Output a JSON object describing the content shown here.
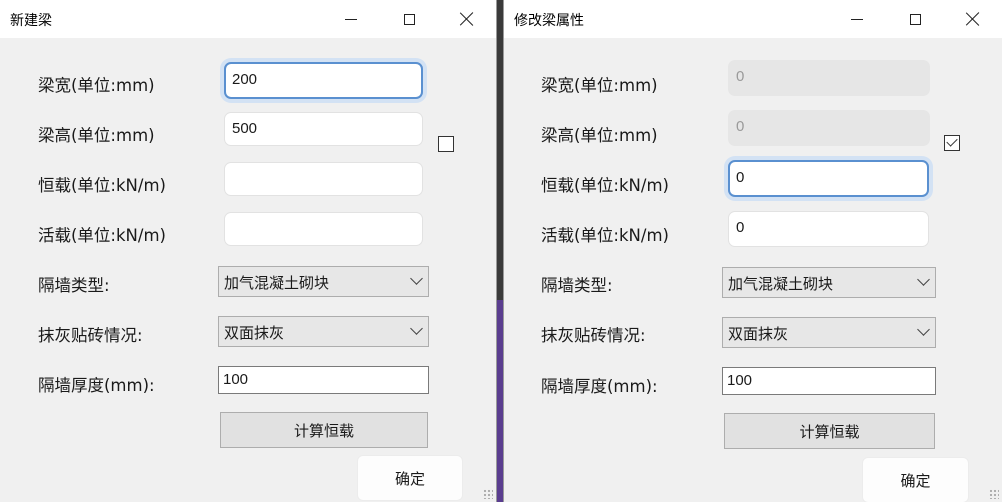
{
  "dialog_new": {
    "title": "新建梁",
    "labels": {
      "width": "梁宽(单位:mm)",
      "height": "梁高(单位:mm)",
      "dead_load": "恒载(单位:kN/m)",
      "live_load": "活载(单位:kN/m)",
      "wall_type": "隔墙类型:",
      "plaster": "抹灰贴砖情况:",
      "wall_thickness": "隔墙厚度(mm):"
    },
    "values": {
      "width": "200",
      "height": "500",
      "dead_load": "",
      "live_load": "",
      "wall_type": "加气混凝土砌块",
      "plaster": "双面抹灰",
      "wall_thickness": "100"
    },
    "checkbox_checked": false,
    "calc_button": "计算恒载",
    "ok_button": "确定"
  },
  "dialog_edit": {
    "title": "修改梁属性",
    "labels": {
      "width": "梁宽(单位:mm)",
      "height": "梁高(单位:mm)",
      "dead_load": "恒载(单位:kN/m)",
      "live_load": "活载(单位:kN/m)",
      "wall_type": "隔墙类型:",
      "plaster": "抹灰贴砖情况:",
      "wall_thickness": "隔墙厚度(mm):"
    },
    "values": {
      "width": "0",
      "height": "0",
      "dead_load": "0",
      "live_load": "0",
      "wall_type": "加气混凝土砌块",
      "plaster": "双面抹灰",
      "wall_thickness": "100"
    },
    "checkbox_checked": true,
    "calc_button": "计算恒载",
    "ok_button": "确定"
  },
  "colors": {
    "focus_border": "#5a90d0",
    "dialog_bg": "#f0f0f0"
  }
}
